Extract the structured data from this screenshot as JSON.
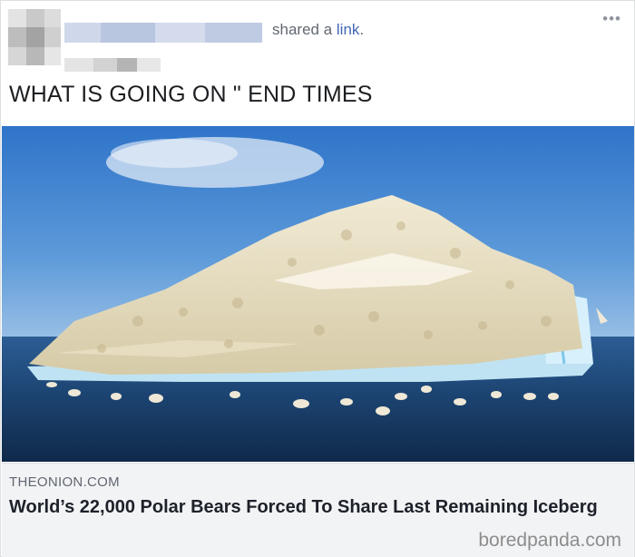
{
  "post": {
    "shared_prefix": "shared a",
    "shared_link": "link",
    "shared_suffix": ".",
    "more_icon": "more-horizontal-icon",
    "more_glyph": "•••",
    "text": "WHAT IS GOING ON \" END TIMES"
  },
  "photo": {
    "subject": "iceberg covered with polar bears"
  },
  "link_preview": {
    "domain": "THEONION.COM",
    "headline": "World’s 22,000 Polar Bears Forced To Share Last Remaining Iceberg"
  },
  "watermark": "boredpanda.com",
  "colors": {
    "link": "#4267b2",
    "meta_text": "#616770",
    "preview_bg": "#f2f3f5",
    "sky": "#4f8fd6",
    "sea": "#1f4f86"
  }
}
